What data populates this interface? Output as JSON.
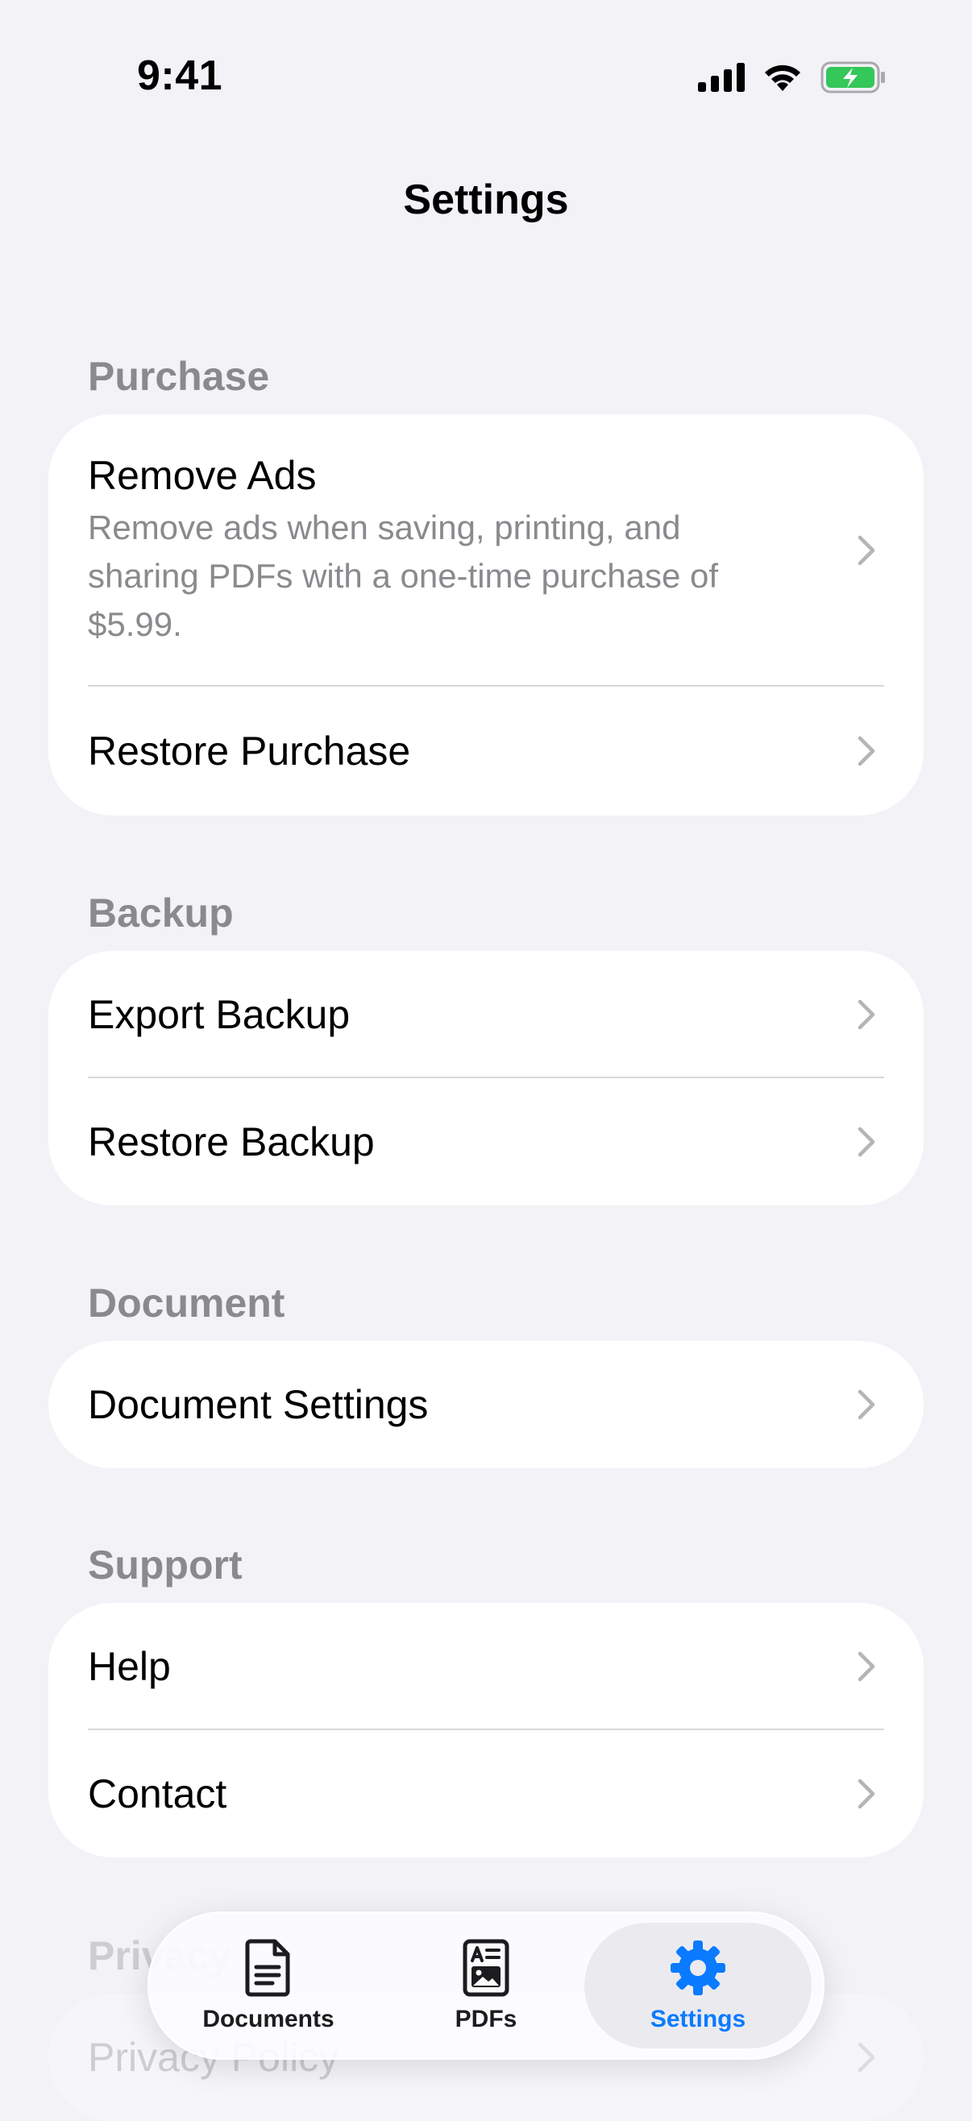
{
  "status_bar": {
    "time": "9:41"
  },
  "nav": {
    "title": "Settings"
  },
  "sections": {
    "purchase": {
      "header": "Purchase",
      "remove_ads_title": "Remove Ads",
      "remove_ads_subtitle": "Remove ads when saving, printing, and sharing PDFs with a one-time purchase of $5.99.",
      "restore_purchase": "Restore Purchase"
    },
    "backup": {
      "header": "Backup",
      "export_backup": "Export Backup",
      "restore_backup": "Restore Backup"
    },
    "document": {
      "header": "Document",
      "document_settings": "Document Settings"
    },
    "support": {
      "header": "Support",
      "help": "Help",
      "contact": "Contact"
    },
    "privacy": {
      "header": "Privacy",
      "privacy_policy": "Privacy Policy"
    }
  },
  "tabbar": {
    "tabs": [
      {
        "label": "Documents",
        "icon": "document-icon",
        "active": false
      },
      {
        "label": "PDFs",
        "icon": "pdf-icon",
        "active": false
      },
      {
        "label": "Settings",
        "icon": "gear-icon",
        "active": true
      }
    ]
  },
  "colors": {
    "background": "#f2f2f7",
    "card": "#ffffff",
    "secondary_text": "#8a8a8e",
    "accent": "#0a7aff",
    "battery_green": "#34c759"
  }
}
